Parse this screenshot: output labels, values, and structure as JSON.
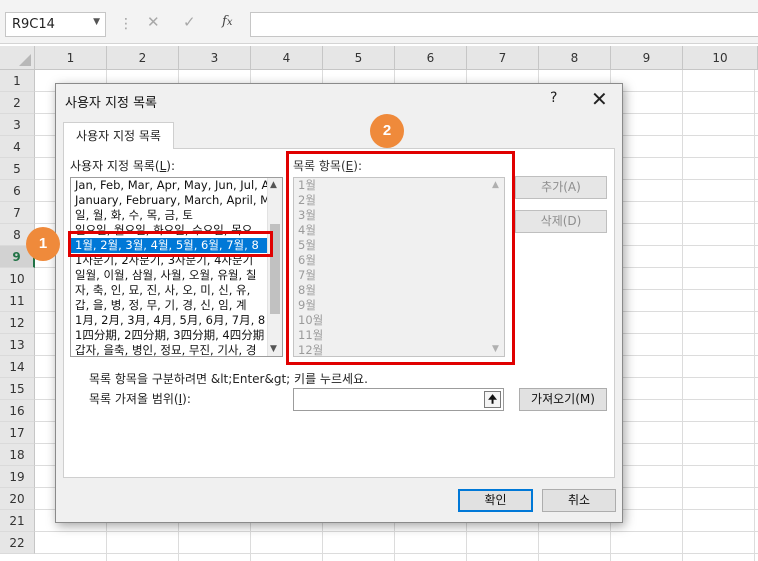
{
  "formula_bar": {
    "name_box": "R9C14",
    "name_box_dropdown_icon": "chevron-down",
    "cancel_icon": "✕",
    "enter_icon": "✓",
    "fx_label": "fx",
    "formula_value": ""
  },
  "grid": {
    "columns": [
      "1",
      "2",
      "3",
      "4",
      "5",
      "6",
      "7",
      "8",
      "9",
      "10"
    ],
    "rows": [
      "1",
      "2",
      "3",
      "4",
      "5",
      "6",
      "7",
      "8",
      "9",
      "10",
      "11",
      "12",
      "13",
      "14",
      "15",
      "16",
      "17",
      "18",
      "19",
      "20",
      "21",
      "22"
    ],
    "selected_row": "9"
  },
  "dialog": {
    "title": "사용자 지정 목록",
    "help": "?",
    "close": "✕",
    "tab": "사용자 지정 목록",
    "lists_label_prefix": "사용자 지정 목록(",
    "lists_label_key": "L",
    "lists_label_suffix": "):",
    "lists": [
      "Jan, Feb, Mar, Apr, May, Jun, Jul, A",
      "January, February, March, April, Ma",
      "일, 월, 화, 수, 목, 금, 토",
      "일요일, 월요일, 화요일, 수요일, 목요",
      "1월, 2월, 3월, 4월, 5월, 6월, 7월, 8",
      "1사분기, 2사분기, 3사분기, 4사분기",
      "일월, 이월, 삼월, 사월, 오월, 유월, 칠",
      "자, 축, 인, 묘, 진, 사, 오, 미, 신, 유,",
      "갑, 을, 병, 정, 무, 기, 경, 신, 임, 계",
      "1月, 2月, 3月, 4月, 5月, 6月, 7月, 8",
      "1四分期, 2四分期, 3四分期, 4四分期",
      "갑자, 을축, 병인, 정묘, 무진, 기사, 경"
    ],
    "selected_index": 4,
    "entries_label_prefix": "목록 항목(",
    "entries_label_key": "E",
    "entries_label_suffix": "):",
    "entries": [
      "1월",
      "2월",
      "3월",
      "4월",
      "5월",
      "6월",
      "7월",
      "8월",
      "9월",
      "10월",
      "11월",
      "12월"
    ],
    "add_button": "추가(A)",
    "delete_button": "삭제(D)",
    "hint_text": "목록 항목을 구분하려면 &lt;Enter&gt; 키를 누르세요.",
    "import_label_prefix": "목록 가져올 범위(",
    "import_label_key": "I",
    "import_label_suffix": "):",
    "import_range_value": "",
    "import_button": "가져오기(M)",
    "ok_button": "확인",
    "cancel_button": "취소"
  },
  "annotations": {
    "badge1": "1",
    "badge2": "2",
    "badge_color": "#ef8a3b",
    "box_color": "#e00000"
  },
  "colors": {
    "selection": "#0078d7",
    "excel_green": "#217346"
  }
}
